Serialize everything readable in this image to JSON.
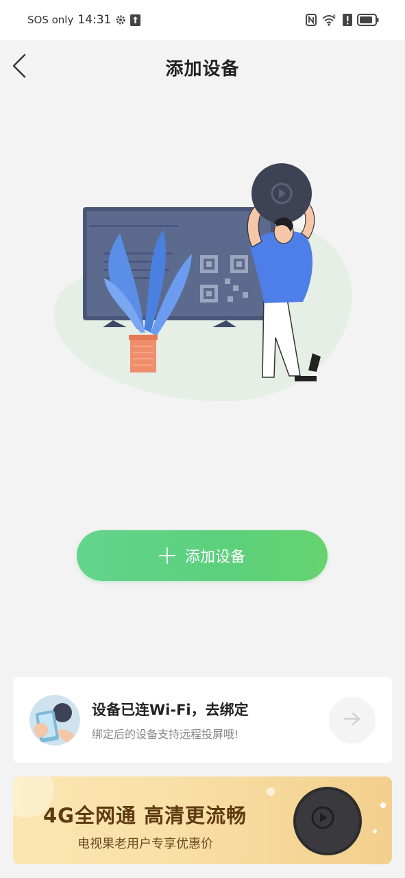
{
  "status_bar": {
    "carrier": "SOS only",
    "time": "14:31",
    "icons": [
      "gear-icon",
      "upload-icon",
      "nfc-icon",
      "wifi-icon",
      "alert-icon",
      "battery-icon"
    ]
  },
  "header": {
    "title": "添加设备",
    "back_icon": "chevron-left-icon"
  },
  "main": {
    "add_button_label": "添加设备",
    "add_button_icon": "plus-icon"
  },
  "bind_card": {
    "title": "设备已连Wi-Fi，去绑定",
    "subtitle": "绑定后的设备支持远程投屏哦!",
    "arrow_icon": "arrow-right-icon"
  },
  "promo": {
    "title": "4G全网通 高清更流畅",
    "subtitle": "电视果老用户专享优惠价"
  },
  "colors": {
    "background": "#f3f3f3",
    "accent_green": "#5cd07c",
    "promo_text": "#5d3a12"
  }
}
